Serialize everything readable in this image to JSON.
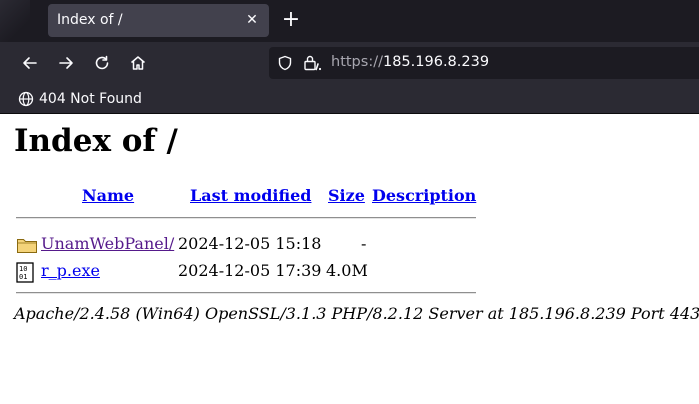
{
  "browser": {
    "tab_title": "Index of /",
    "tab_close": "✕",
    "new_tab": "+",
    "url_scheme": "https://",
    "url_host": "185.196.8.239",
    "bookmark_label": "404 Not Found"
  },
  "page": {
    "heading": "Index of /",
    "columns": {
      "name": "Name",
      "last_modified": "Last modified",
      "size": "Size",
      "description": "Description"
    },
    "entries": [
      {
        "icon": "folder-icon",
        "name": "UnamWebPanel/",
        "modified": "2024-12-05 15:18",
        "size": "-"
      },
      {
        "icon": "binary-file-icon",
        "name": "r_p.exe",
        "modified": "2024-12-05 17:39",
        "size": "4.0M"
      }
    ],
    "address": "Apache/2.4.58 (Win64) OpenSSL/3.1.3 PHP/8.2.12 Server at 185.196.8.239 Port 443"
  },
  "colors": {
    "link": "#0000ee",
    "visited_link": "#551a8b",
    "chrome_dark": "#1c1b22",
    "chrome": "#2b2a33"
  }
}
